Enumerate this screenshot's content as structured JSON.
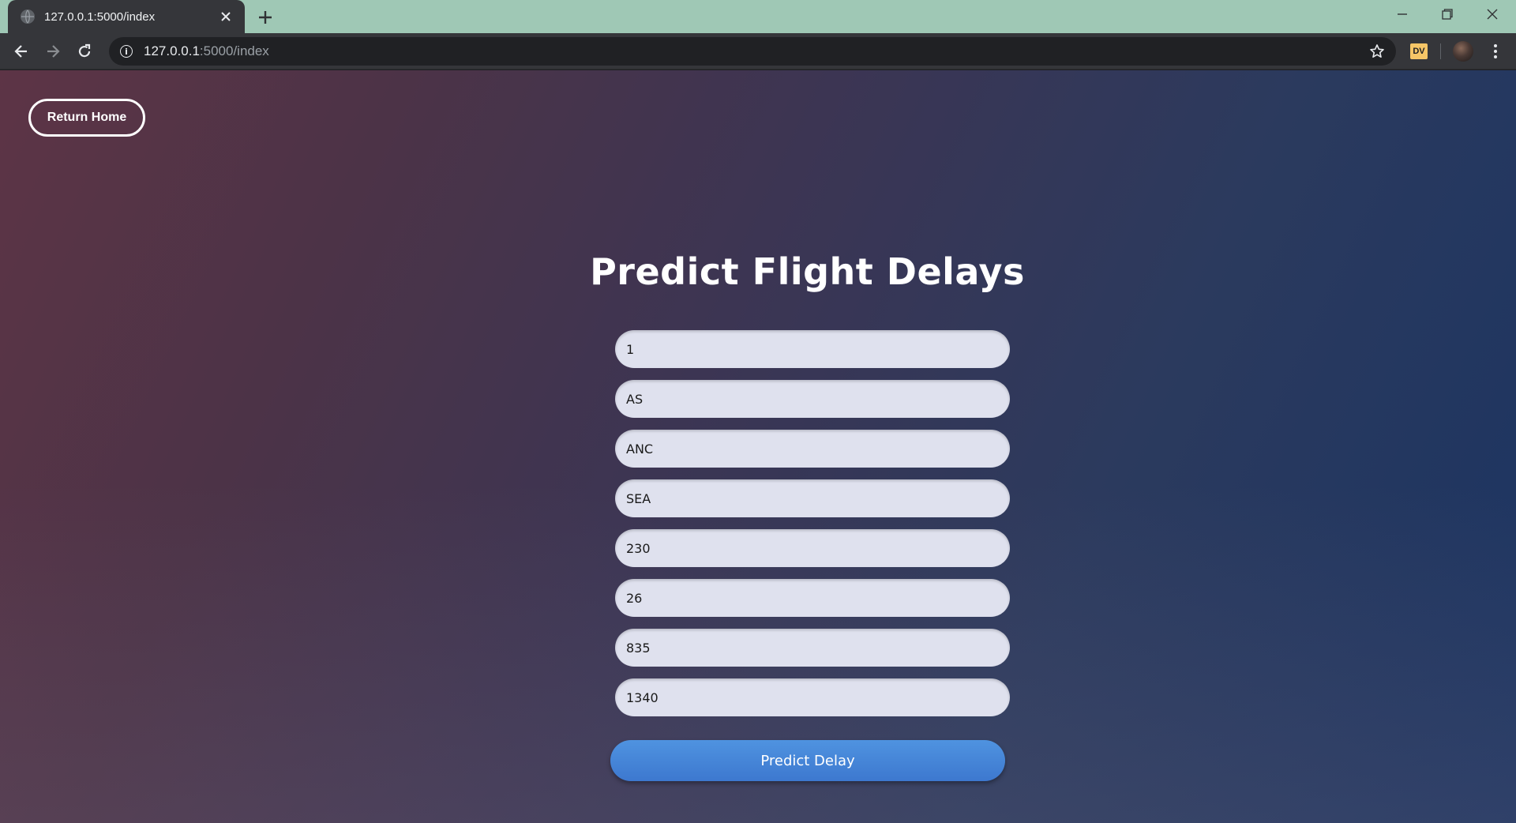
{
  "browser": {
    "tab_title": "127.0.0.1:5000/index",
    "address": {
      "host": "127.0.0.1",
      "path": ":5000/index"
    },
    "extension_label": "DV"
  },
  "page": {
    "home_button": "Return Home",
    "title": "Predict Flight Delays",
    "fields": [
      "1",
      "AS",
      "ANC",
      "SEA",
      "230",
      "26",
      "835",
      "1340"
    ],
    "submit_button": "Predict Delay"
  }
}
